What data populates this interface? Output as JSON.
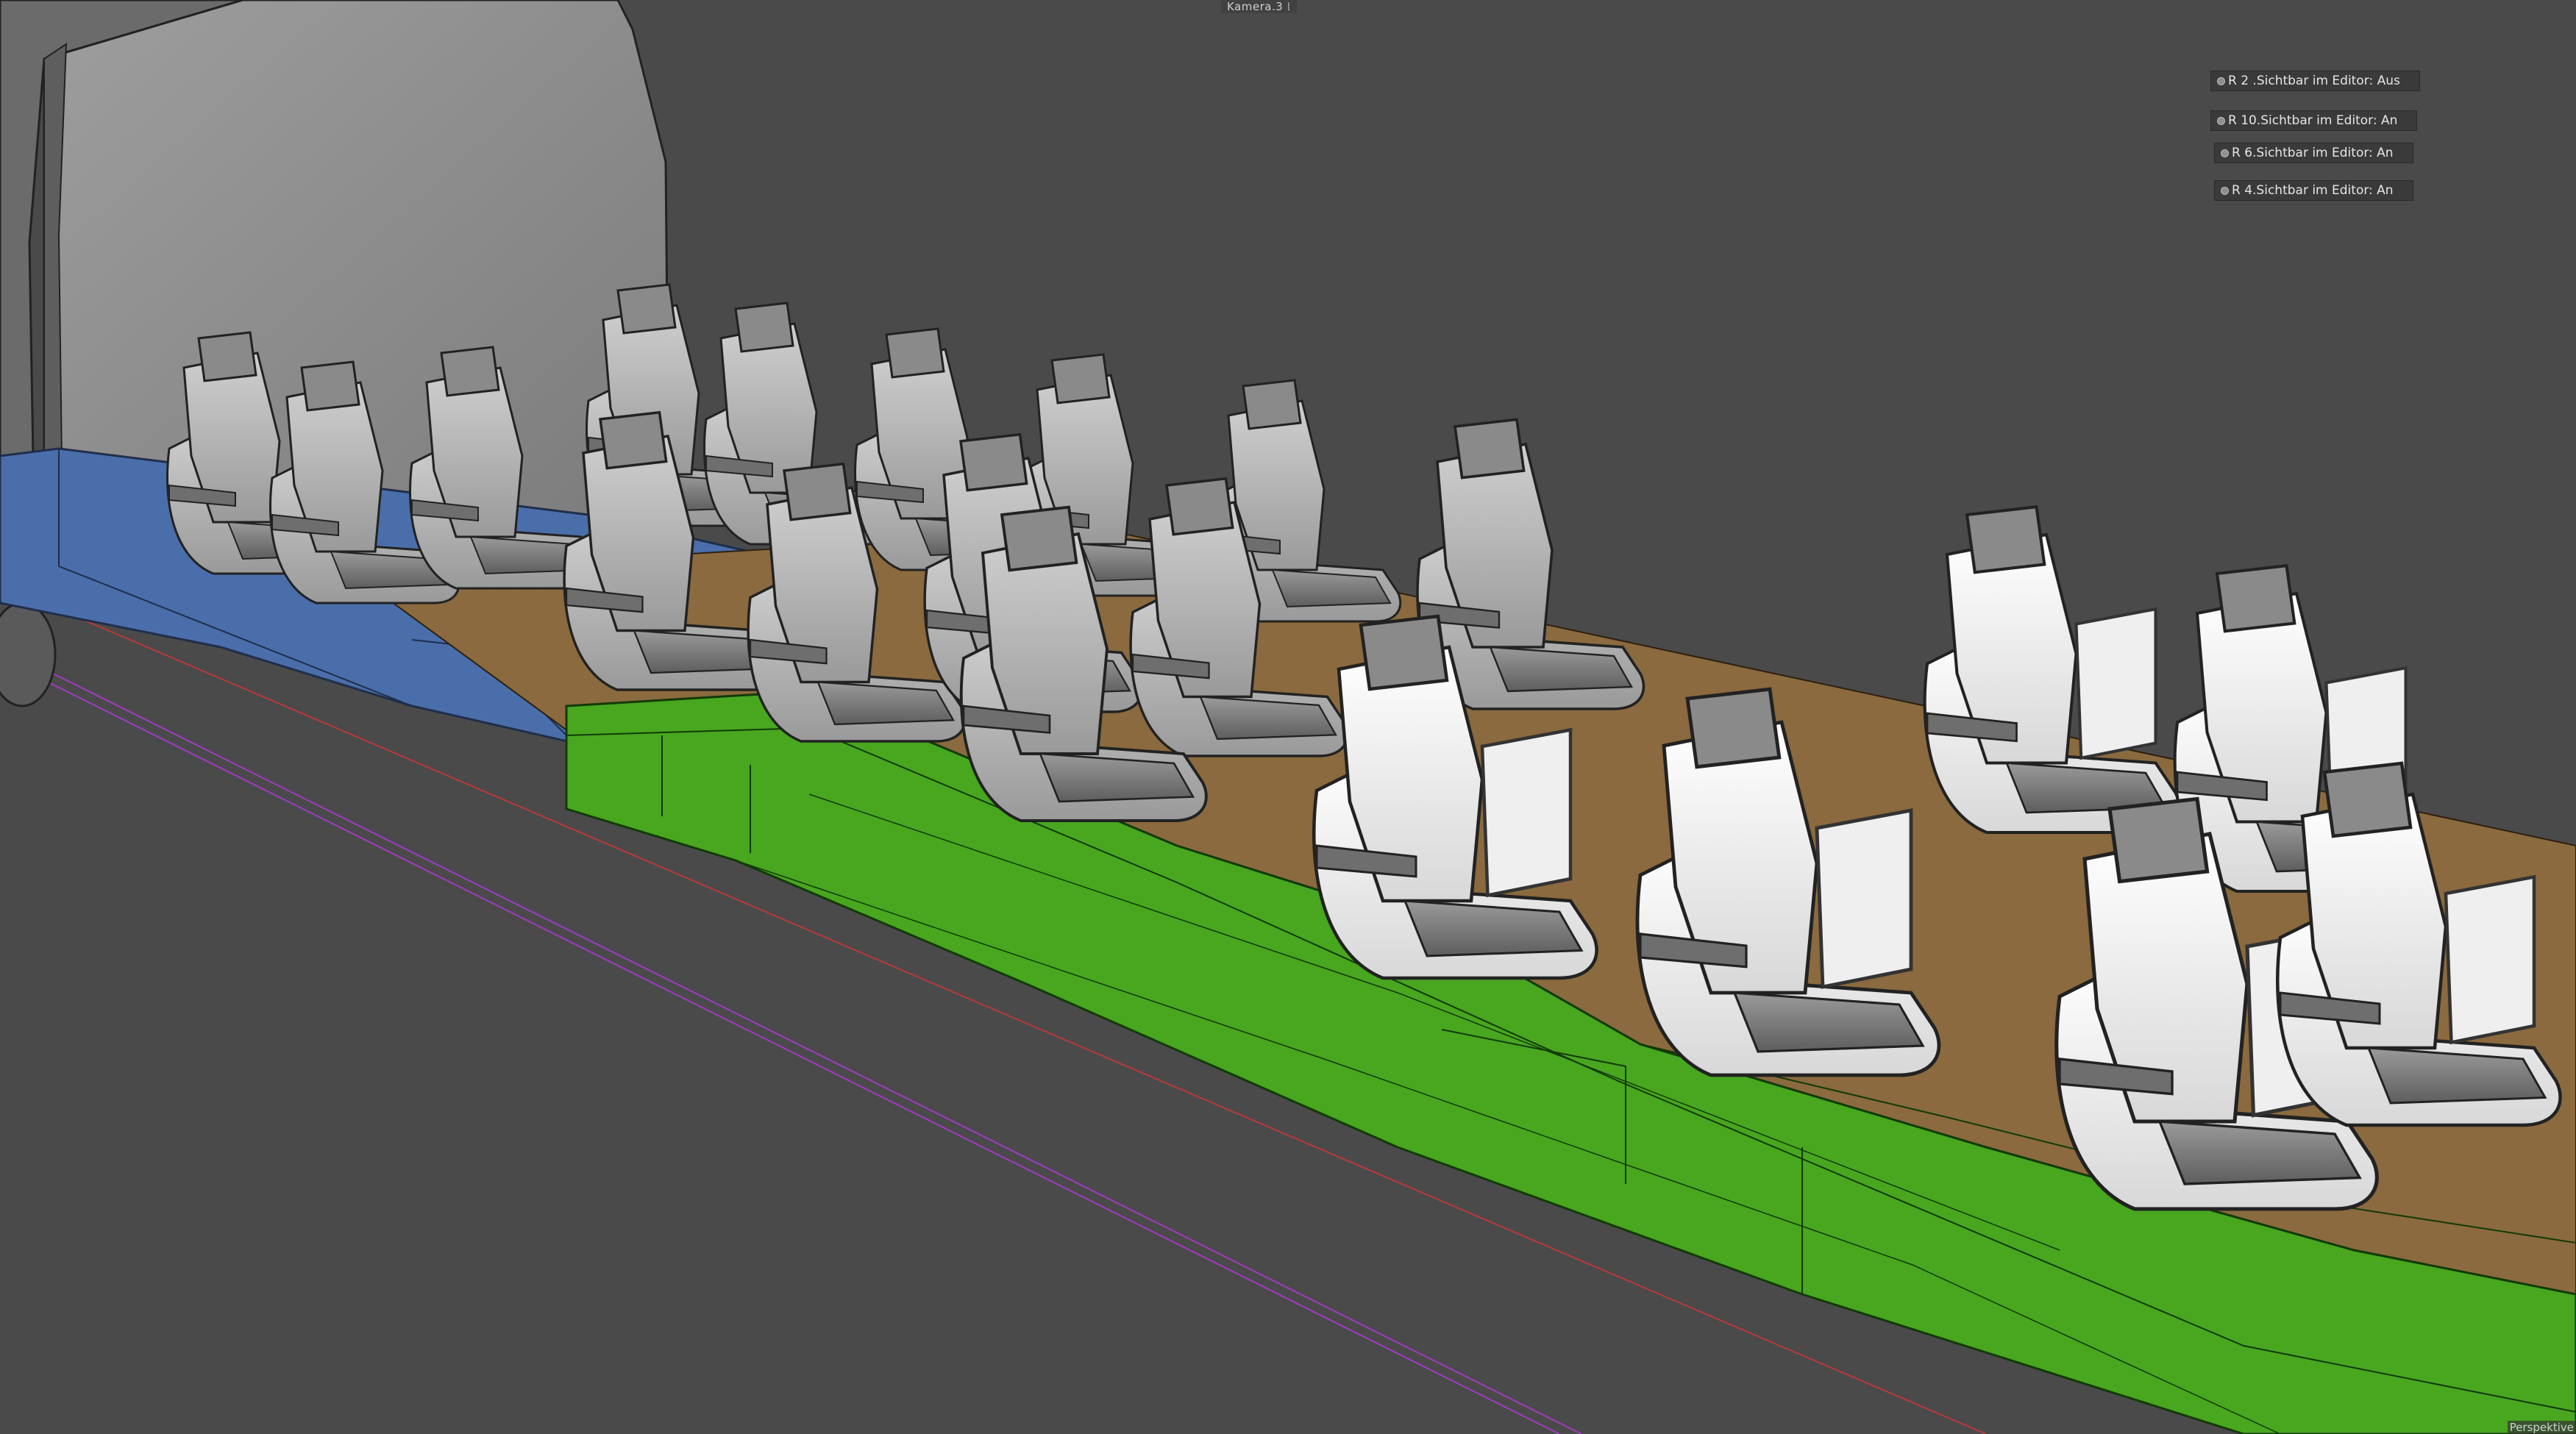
{
  "viewport": {
    "camera_label": "Kamera.3 ⁞",
    "projection_label": "Perspektive"
  },
  "layer_tags": [
    {
      "label": "R 2  .Sichtbar im Editor: Aus"
    },
    {
      "label": "R 10.Sichtbar im Editor: An"
    },
    {
      "label": "R 6.Sichtbar im Editor: An"
    },
    {
      "label": "R 4.Sichtbar im Editor: An"
    }
  ],
  "colors": {
    "background": "#4a4a4a",
    "floor_green": "#48a61f",
    "floor_blue": "#4a6eaa",
    "floor_brown": "#8a6a3e",
    "seat_white": "#f2f2f2",
    "seat_gray": "#8a8a8a",
    "cabin_wall": "#8c8c8c",
    "guide_red": "#b83a3a",
    "guide_magenta": "#a03bc0"
  },
  "icons": [
    "layer-dot-icon"
  ]
}
